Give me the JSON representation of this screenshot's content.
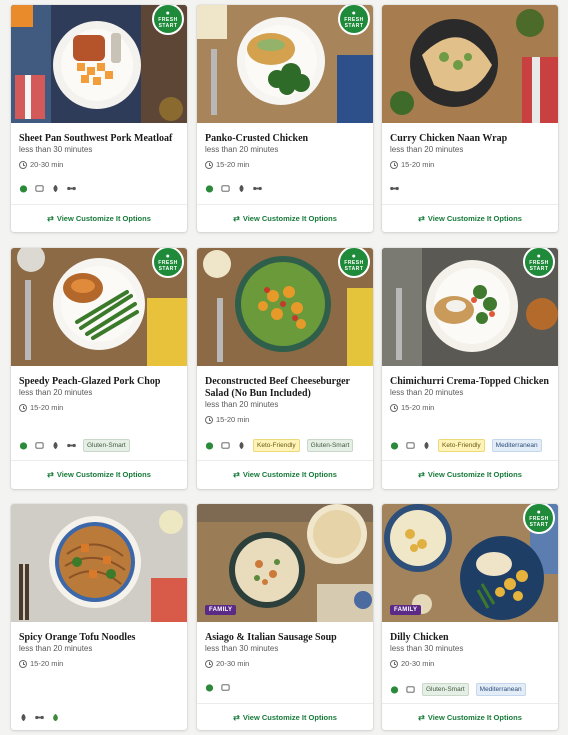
{
  "cta_label": "View Customize It Options",
  "badges": {
    "fresh_start": "FRESH START",
    "family": "FAMILY"
  },
  "cards": [
    {
      "title": "Sheet Pan Southwest Pork Meatloaf",
      "subtitle": "less than 30 minutes",
      "time": "20-30 min",
      "icons": [
        "apple-icon",
        "calorie-icon",
        "carb-icon",
        "protein-icon"
      ],
      "tags": [],
      "fresh_start": true,
      "family": false
    },
    {
      "title": "Panko-Crusted Chicken",
      "subtitle": "less than 20 minutes",
      "time": "15-20 min",
      "icons": [
        "apple-icon",
        "calorie-icon",
        "carb-icon",
        "protein-icon"
      ],
      "tags": [],
      "fresh_start": true,
      "family": false
    },
    {
      "title": "Curry Chicken Naan Wrap",
      "subtitle": "less than 20 minutes",
      "time": "15-20 min",
      "icons": [
        "protein-icon"
      ],
      "tags": [],
      "fresh_start": false,
      "family": false
    },
    {
      "title": "Speedy Peach-Glazed Pork Chop",
      "subtitle": "less than 20 minutes",
      "time": "15-20 min",
      "icons": [
        "apple-icon",
        "calorie-icon",
        "carb-icon",
        "protein-icon"
      ],
      "tags": [
        "Gluten-Smart"
      ],
      "fresh_start": true,
      "family": false
    },
    {
      "title": "Deconstructed Beef Cheeseburger Salad (No Bun Included)",
      "subtitle": "less than 20 minutes",
      "time": "15-20 min",
      "icons": [
        "apple-icon",
        "calorie-icon",
        "carb-icon"
      ],
      "tags": [
        "Keto-Friendly",
        "Gluten-Smart"
      ],
      "fresh_start": true,
      "family": false
    },
    {
      "title": "Chimichurri Crema-Topped Chicken",
      "subtitle": "less than 20 minutes",
      "time": "15-20 min",
      "icons": [
        "apple-icon",
        "calorie-icon",
        "carb-icon"
      ],
      "tags": [
        "Keto-Friendly",
        "Mediterranean"
      ],
      "fresh_start": true,
      "family": false
    },
    {
      "title": "Spicy Orange Tofu Noodles",
      "subtitle": "less than 20 minutes",
      "time": "15-20 min",
      "icons": [
        "carb-icon",
        "protein-icon",
        "leaf-icon"
      ],
      "tags": [],
      "fresh_start": false,
      "family": false
    },
    {
      "title": "Asiago & Italian Sausage Soup",
      "subtitle": "less than 30 minutes",
      "time": "20-30 min",
      "icons": [
        "apple-icon",
        "calorie-icon"
      ],
      "tags": [],
      "fresh_start": false,
      "family": true
    },
    {
      "title": "Dilly Chicken",
      "subtitle": "less than 30 minutes",
      "time": "20-30 min",
      "icons": [
        "apple-icon",
        "calorie-icon"
      ],
      "tags": [
        "Gluten-Smart",
        "Mediterranean"
      ],
      "fresh_start": true,
      "family": true
    }
  ],
  "colors": {
    "accent_green": "#187a3a",
    "fresh_badge": "#1f8a3a",
    "family_badge": "#5b2a86"
  }
}
